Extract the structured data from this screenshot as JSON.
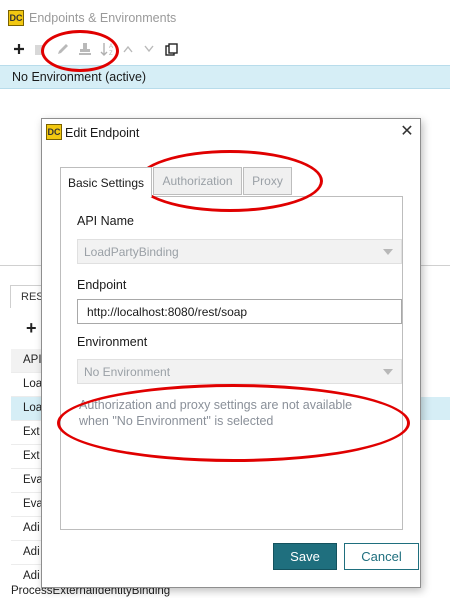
{
  "background_window": {
    "title": "Endpoints & Environments",
    "app_icon_text": "DC",
    "toolbar": {
      "add_icon": "plus-icon",
      "delete_icon": "trash-icon",
      "edit_icon": "pencil-icon",
      "default_icon": "stamp-icon",
      "sort_icon": "sort-az-icon",
      "up_icon": "chevron-up-icon",
      "down_icon": "chevron-down-icon",
      "copy_icon": "copy-icon"
    },
    "environment_row": "No Environment (active)",
    "lower_tab_label": "RES",
    "lower_add_glyph": "+",
    "list_rows": [
      "API",
      "Loa",
      "Loa",
      "Ext",
      "Ext",
      "Eva",
      "Eva",
      "Adi",
      "Adi",
      "Adi"
    ],
    "last_row": "ProcessExternalIdentityBinding"
  },
  "dialog": {
    "title": "Edit Endpoint",
    "close_glyph": "✕",
    "tabs": [
      {
        "label": "Basic Settings",
        "state": "active"
      },
      {
        "label": "Authorization",
        "state": "disabled"
      },
      {
        "label": "Proxy",
        "state": "disabled"
      }
    ],
    "api_name_label": "API Name",
    "api_name_value": "LoadPartyBinding",
    "endpoint_label": "Endpoint",
    "endpoint_value": "http://localhost:8080/rest/soap",
    "environment_label": "Environment",
    "environment_value": "No Environment",
    "note_line1": "Authorization and proxy settings are not available",
    "note_line2": "when \"No Environment\" is selected",
    "save_label": "Save",
    "cancel_label": "Cancel"
  },
  "colors": {
    "accent": "#1f6f7e",
    "selection": "#d6eef6",
    "annotation": "#e00000"
  }
}
